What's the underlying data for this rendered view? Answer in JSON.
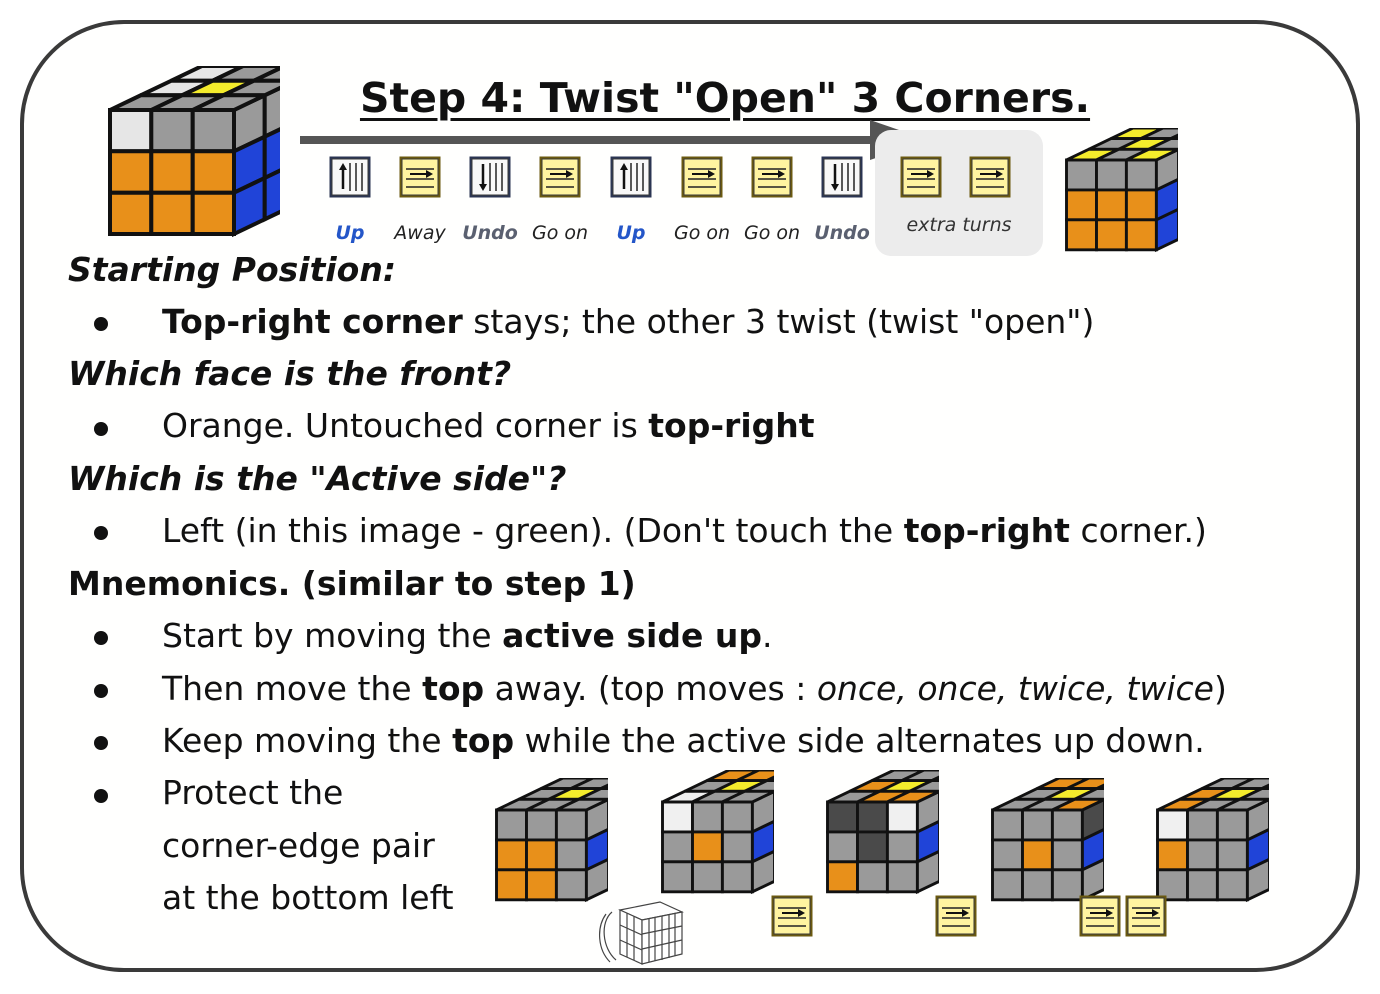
{
  "title": "Step 4: Twist \"Open\" 3 Corners.",
  "moves": [
    {
      "icon": "up-icon",
      "label": "Up",
      "kind": "up"
    },
    {
      "icon": "away-icon",
      "label": "Away",
      "kind": "plain"
    },
    {
      "icon": "undo-icon",
      "label": "Undo",
      "kind": "undo"
    },
    {
      "icon": "away-icon",
      "label": "Go on",
      "kind": "plain"
    },
    {
      "icon": "up-icon",
      "label": "Up",
      "kind": "up"
    },
    {
      "icon": "away-icon",
      "label": "Go on",
      "kind": "plain"
    },
    {
      "icon": "away-icon",
      "label": "Go on",
      "kind": "plain"
    },
    {
      "icon": "undo-icon",
      "label": "Undo",
      "kind": "undo"
    },
    {
      "icon": "away-icon",
      "label": "",
      "kind": "extra"
    },
    {
      "icon": "away-icon",
      "label": "",
      "kind": "extra"
    }
  ],
  "extra_turns_label": "extra turns",
  "sections": {
    "starting": {
      "heading": "Starting Position:",
      "bullet": {
        "bold": "Top-right corner",
        "rest": " stays; the other 3 twist (twist \"open\")"
      }
    },
    "front": {
      "heading": "Which face is the front?",
      "bullet": {
        "pre": "Orange. Untouched corner is ",
        "bold": "top-right"
      }
    },
    "active": {
      "heading": "Which is the \"Active side\"?",
      "bullet": {
        "pre": "Left (in this image - green). (Don't touch the ",
        "bold": "top-right",
        "post": " corner.)"
      }
    },
    "mnemonics": {
      "heading": "Mnemonics. (similar to step 1)",
      "b1": {
        "pre": "Start by moving the ",
        "bold": "active side up",
        "post": "."
      },
      "b2": {
        "pre": "Then move the ",
        "bold": "top",
        "mid": " away. (top moves : ",
        "ital": "once, once, twice, twice",
        "post": ")"
      },
      "b3": {
        "pre": "Keep moving the ",
        "bold": "top",
        "post": " while the active side alternates up down."
      },
      "b4": [
        "Protect the",
        "corner-edge pair",
        "at the bottom left"
      ]
    }
  },
  "colors": {
    "orange": "#e8901a",
    "blue": "#2044d8",
    "yellow": "#f4ec2c",
    "grey": "#9a9a9a",
    "dark": "#4a4a4a",
    "white": "#f0f0f0",
    "icon_yellow": "#fff4a0"
  }
}
